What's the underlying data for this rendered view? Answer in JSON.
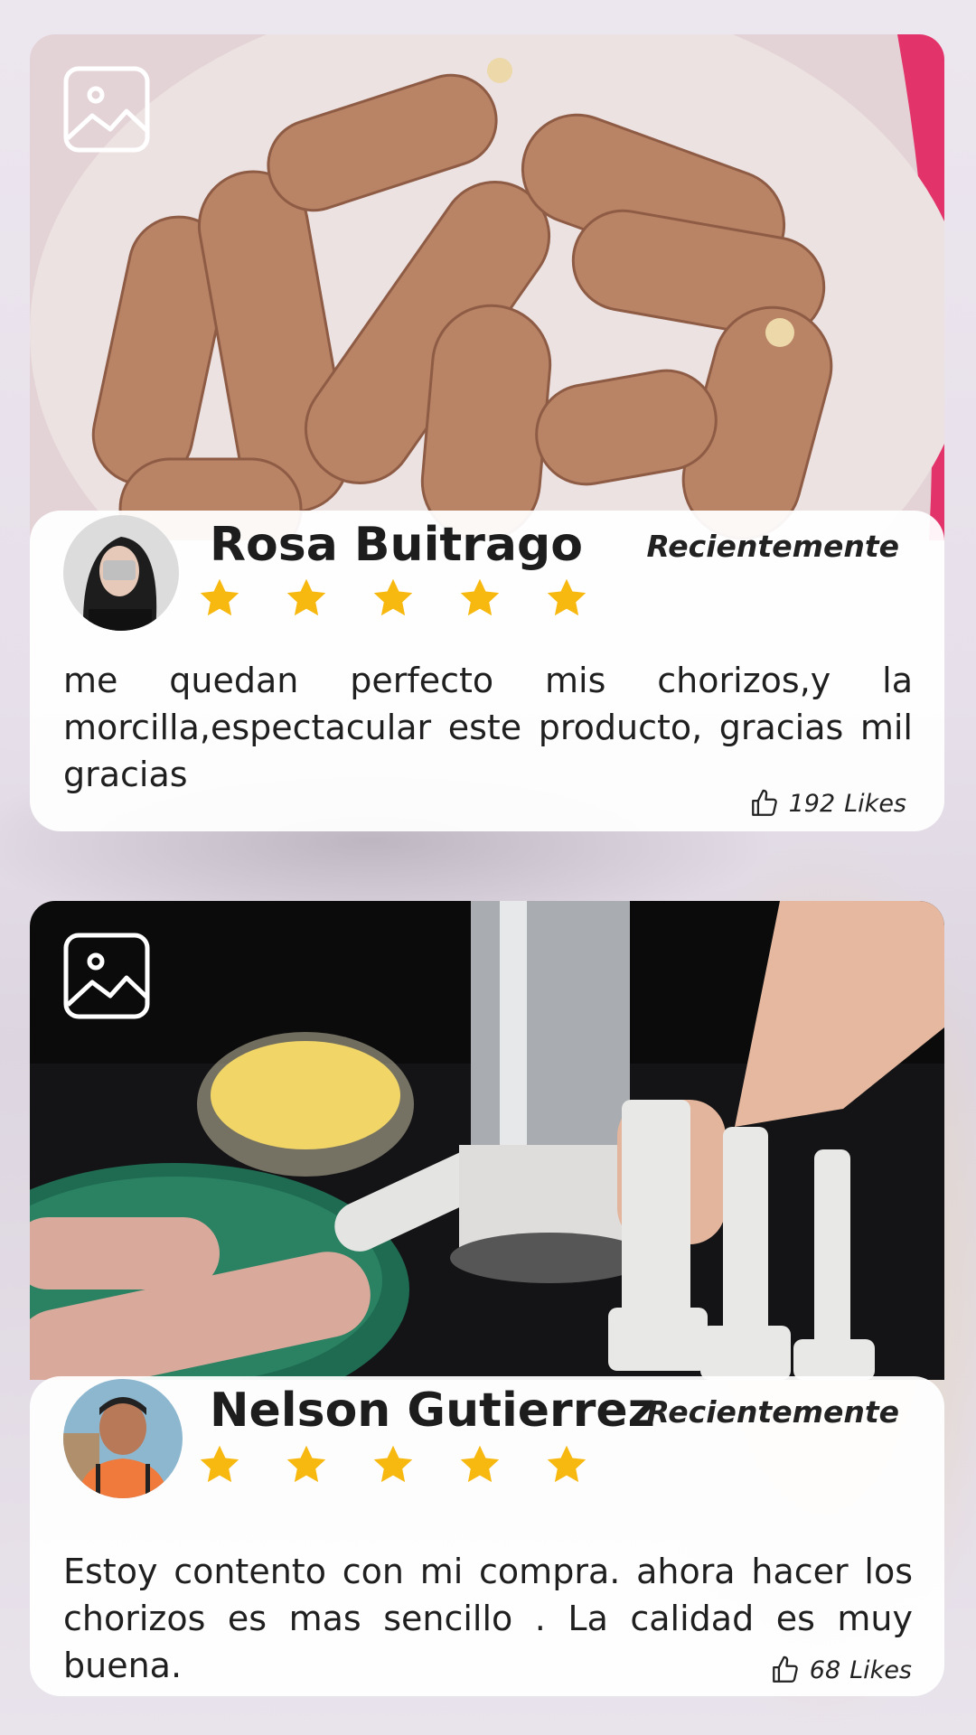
{
  "reviews": [
    {
      "name": "Rosa Buitrago",
      "time": "Recientemente",
      "rating": 5,
      "text": "me quedan perfecto mis chorizos,y la morcilla,espectacular este producto, gracias mil gracias",
      "likes_count": "192",
      "likes_label": "Likes"
    },
    {
      "name": "Nelson Gutierrez",
      "time": "Recientemente",
      "rating": 5,
      "text": "Estoy contento con mi compra. ahora hacer los chorizos es mas sencillo . La calidad es muy buena.",
      "likes_count": "68",
      "likes_label": "Likes"
    }
  ],
  "colors": {
    "star": "#f7b80f",
    "card_bg": "#ffffff",
    "text": "#1f1f1f"
  },
  "icons": [
    "image-icon",
    "star-icon",
    "thumbs-up-icon"
  ]
}
